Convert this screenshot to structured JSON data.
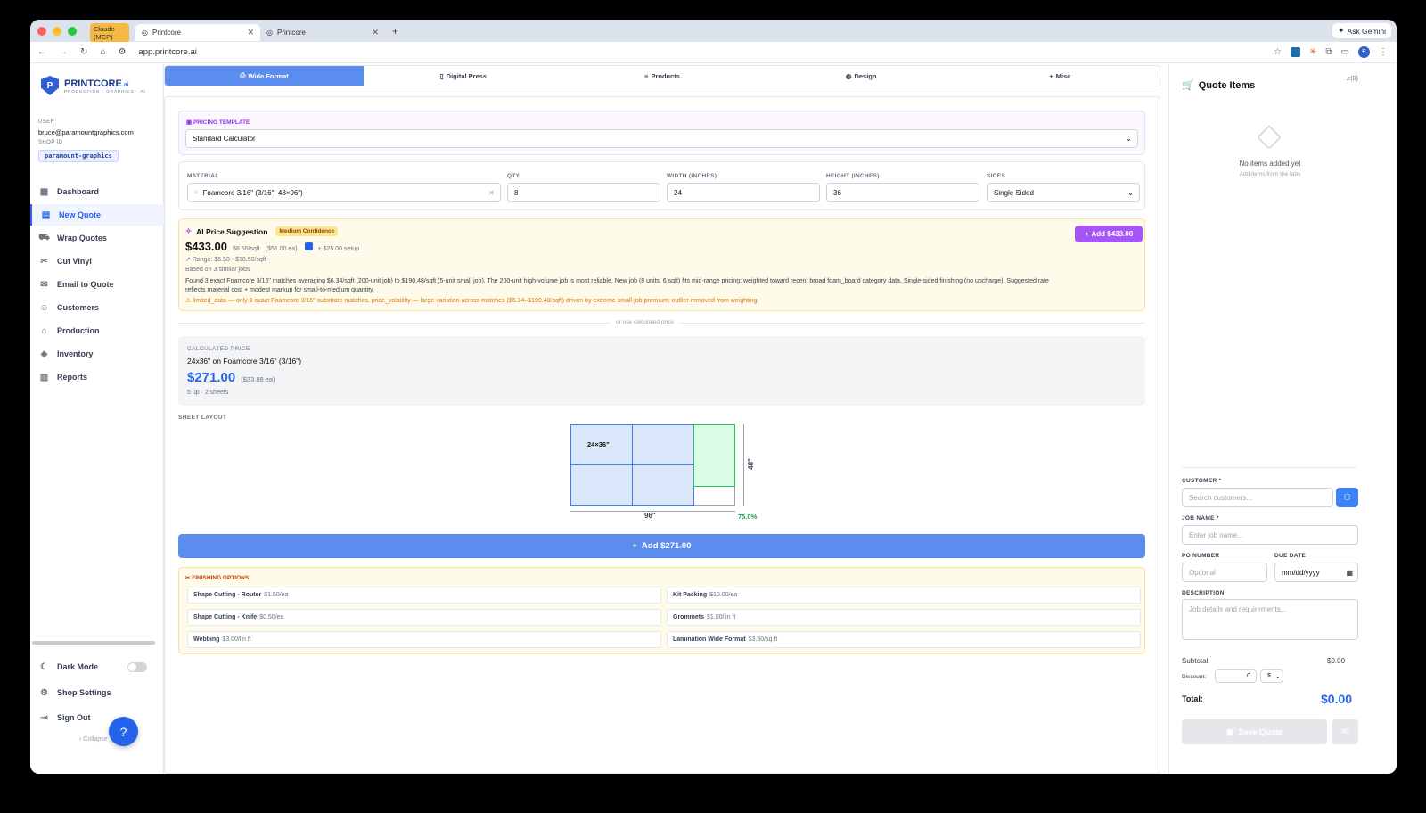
{
  "browser": {
    "tabs": [
      {
        "label": "Claude (MCP)"
      },
      {
        "label": "Printcore"
      },
      {
        "label": "Printcore"
      }
    ],
    "url": "app.printcore.ai",
    "ask": "Ask Gemini",
    "profile": "B"
  },
  "sidebar": {
    "logo_main": "PRINTCORE",
    "logo_suffix": ".ai",
    "logo_sub": "PRODUCTION · GRAPHICS · AI",
    "user_label": "USER",
    "user": "bruce@paramountgraphics.com",
    "shop_label": "SHOP ID",
    "shop": "paramount-graphics",
    "items": [
      {
        "label": "Dashboard"
      },
      {
        "label": "New Quote"
      },
      {
        "label": "Wrap Quotes"
      },
      {
        "label": "Cut Vinyl"
      },
      {
        "label": "Email to Quote"
      },
      {
        "label": "Customers"
      },
      {
        "label": "Production"
      },
      {
        "label": "Inventory"
      },
      {
        "label": "Reports"
      }
    ],
    "dark_mode": "Dark Mode",
    "settings": "Shop Settings",
    "signout": "Sign Out",
    "collapse": "Collapse"
  },
  "tabs": [
    {
      "label": "Wide Format"
    },
    {
      "label": "Digital Press"
    },
    {
      "label": "Products"
    },
    {
      "label": "Design"
    },
    {
      "label": "Misc"
    }
  ],
  "template": {
    "label": "PRICING TEMPLATE",
    "value": "Standard Calculator"
  },
  "form": {
    "material_label": "MATERIAL",
    "material": "Foamcore 3/16\" (3/16\", 48×96\")",
    "qty_label": "QTY",
    "qty": "8",
    "width_label": "WIDTH (INCHES)",
    "width": "24",
    "height_label": "HEIGHT (INCHES)",
    "height": "36",
    "sides_label": "SIDES",
    "sides": "Single Sided"
  },
  "ai": {
    "title": "AI Price Suggestion",
    "confidence": "Medium Confidence",
    "price": "$433.00",
    "rate": "$8.50/sqft",
    "each": "($51.00 ea)",
    "setup": "+ $25.00 setup",
    "range": "Range: $6.50 - $10.50/sqft",
    "based": "Based on 3 similar jobs",
    "desc": "Found 3 exact Foamcore 3/16\" matches averaging $6.34/sqft (200-unit job) to $190.48/sqft (5-unit small job). The 200-unit high-volume job is most reliable. New job (8 units, 6 sqft) fits mid-range pricing; weighted toward recent broad foam_board category data. Single-sided finishing (no upcharge). Suggested rate reflects material cost + modest markup for small-to-medium quantity.",
    "warn": "limited_data — only 3 exact Foamcore 3/16\" substrate matches, price_volatility — large variation across matches ($6.34–$190.48/sqft) driven by extreme small-job premium; outlier removed from weighting",
    "add": "Add $433.00"
  },
  "divider": "or use calculated price",
  "calc": {
    "label": "CALCULATED PRICE",
    "desc": "24x36\" on Foamcore 3/16\" (3/16\")",
    "price": "$271.00",
    "each": "($33.88 ea)",
    "sheets": "5 up · 2 sheets"
  },
  "layout": {
    "label": "SHEET LAYOUT",
    "piece": "24×36\"",
    "height": "48\"",
    "width": "96\"",
    "util": "75.0%"
  },
  "add_calc": "Add $271.00",
  "finishing": {
    "label": "FINISHING OPTIONS",
    "items": [
      {
        "name": "Shape Cutting - Router",
        "price": "$1.50/ea"
      },
      {
        "name": "Kit Packing",
        "price": "$10.00/ea"
      },
      {
        "name": "Shape Cutting - Knife",
        "price": "$0.50/ea"
      },
      {
        "name": "Grommets",
        "price": "$1.00/lin ft"
      },
      {
        "name": "Webbing",
        "price": "$3.00/lin ft"
      },
      {
        "name": "Lamination Wide Format",
        "price": "$3.50/sq ft"
      }
    ]
  },
  "quote": {
    "title": "Quote Items",
    "count": "(0)",
    "empty": "No items added yet",
    "empty_sub": "Add items from the tabs",
    "customer_label": "CUSTOMER *",
    "customer_ph": "Search customers...",
    "job_label": "JOB NAME *",
    "job_ph": "Enter job name...",
    "po_label": "PO NUMBER",
    "po_ph": "Optional",
    "due_label": "DUE DATE",
    "due_ph": "mm/dd/yyyy",
    "desc_label": "DESCRIPTION",
    "desc_ph": "Job details and requirements...",
    "subtotal_label": "Subtotal:",
    "subtotal": "$0.00",
    "discount_label": "Discount:",
    "discount": "0",
    "discount_unit": "$",
    "total_label": "Total:",
    "total": "$0.00",
    "save": "Save Quote"
  }
}
